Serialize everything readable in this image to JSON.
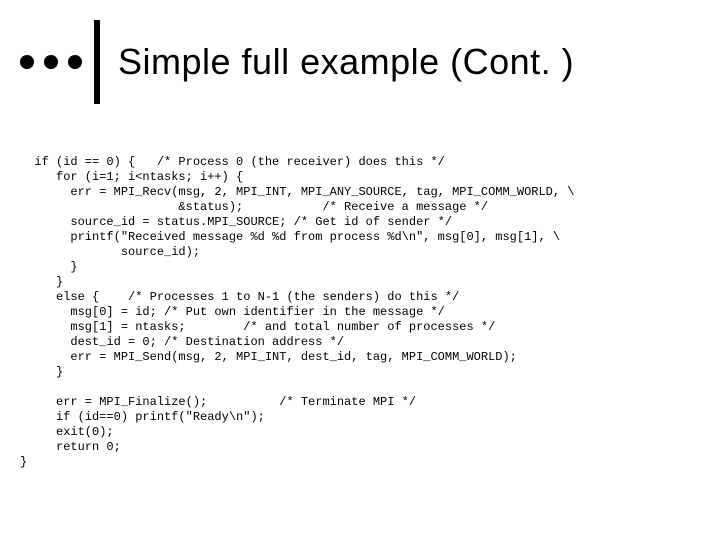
{
  "title": "Simple full example (Cont. )",
  "code_lines": [
    "  if (id == 0) {   /* Process 0 (the receiver) does this */",
    "     for (i=1; i<ntasks; i++) {",
    "       err = MPI_Recv(msg, 2, MPI_INT, MPI_ANY_SOURCE, tag, MPI_COMM_WORLD, \\",
    "                      &status);           /* Receive a message */",
    "       source_id = status.MPI_SOURCE; /* Get id of sender */",
    "       printf(\"Received message %d %d from process %d\\n\", msg[0], msg[1], \\",
    "              source_id);",
    "       }",
    "     }",
    "     else {    /* Processes 1 to N-1 (the senders) do this */",
    "       msg[0] = id; /* Put own identifier in the message */",
    "       msg[1] = ntasks;        /* and total number of processes */",
    "       dest_id = 0; /* Destination address */",
    "       err = MPI_Send(msg, 2, MPI_INT, dest_id, tag, MPI_COMM_WORLD);",
    "     }",
    "",
    "     err = MPI_Finalize();          /* Terminate MPI */",
    "     if (id==0) printf(\"Ready\\n\");",
    "     exit(0);",
    "     return 0;",
    "}"
  ]
}
